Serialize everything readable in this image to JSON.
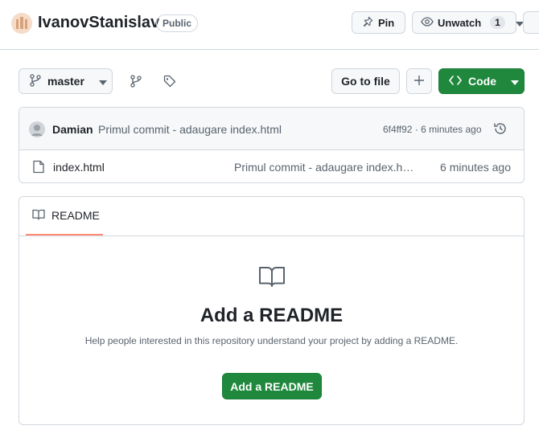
{
  "header": {
    "repo_name": "IvanovStanislav",
    "visibility_badge": "Public",
    "pin_label": "Pin",
    "watch_label": "Unwatch",
    "watch_count": "1"
  },
  "toolbar": {
    "branch_name": "master",
    "goto_file_label": "Go to file",
    "code_label": "Code"
  },
  "latest_commit": {
    "author": "Damian",
    "message": "Primul commit - adaugare index.html",
    "meta": "6f4ff92 · 6 minutes ago"
  },
  "files": [
    {
      "name": "index.html",
      "commit_message": "Primul commit - adaugare index.html",
      "time": "6 minutes ago"
    }
  ],
  "readme": {
    "tab_label": "README",
    "title": "Add a README",
    "description": "Help people interested in this repository understand your project by adding a README.",
    "button_label": "Add a README"
  },
  "colors": {
    "primary_green": "#1f883d",
    "tab_underline": "#fd8c73",
    "border": "#d0d7de",
    "muted_text": "#59636e"
  },
  "icons": [
    "repo-owner-avatar",
    "pin-icon",
    "eye-icon",
    "chevron-down-icon",
    "git-branch-icon",
    "branches-icon",
    "tag-icon",
    "plus-icon",
    "code-icon",
    "history-icon",
    "file-icon",
    "book-icon"
  ]
}
